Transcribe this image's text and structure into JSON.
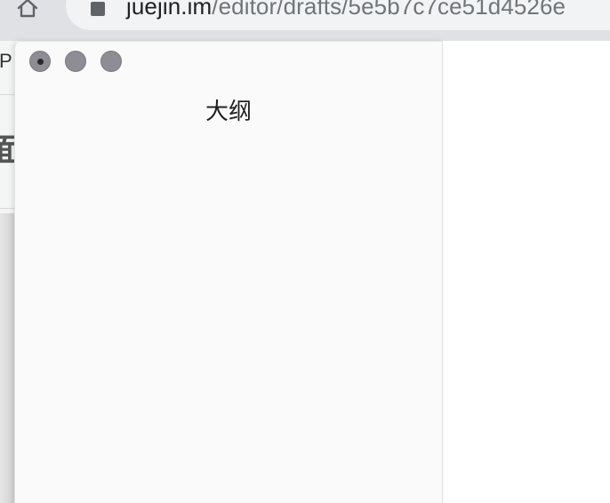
{
  "browser": {
    "url_host": "juejin.im",
    "url_path": "/editor/drafts/5e5b7c7ce51d4526e"
  },
  "page_behind": {
    "fragment_p": "P",
    "fragment_heading": "面"
  },
  "outline_window": {
    "title": "大纲",
    "window_controls": {
      "close_icon": "circle-dot-icon",
      "minimize_icon": "circle-icon",
      "maximize_icon": "circle-icon"
    }
  },
  "colors": {
    "window_bg": "#fafafa",
    "traffic_light": "#8e8d93",
    "address_bar": "#f1f3f4"
  }
}
